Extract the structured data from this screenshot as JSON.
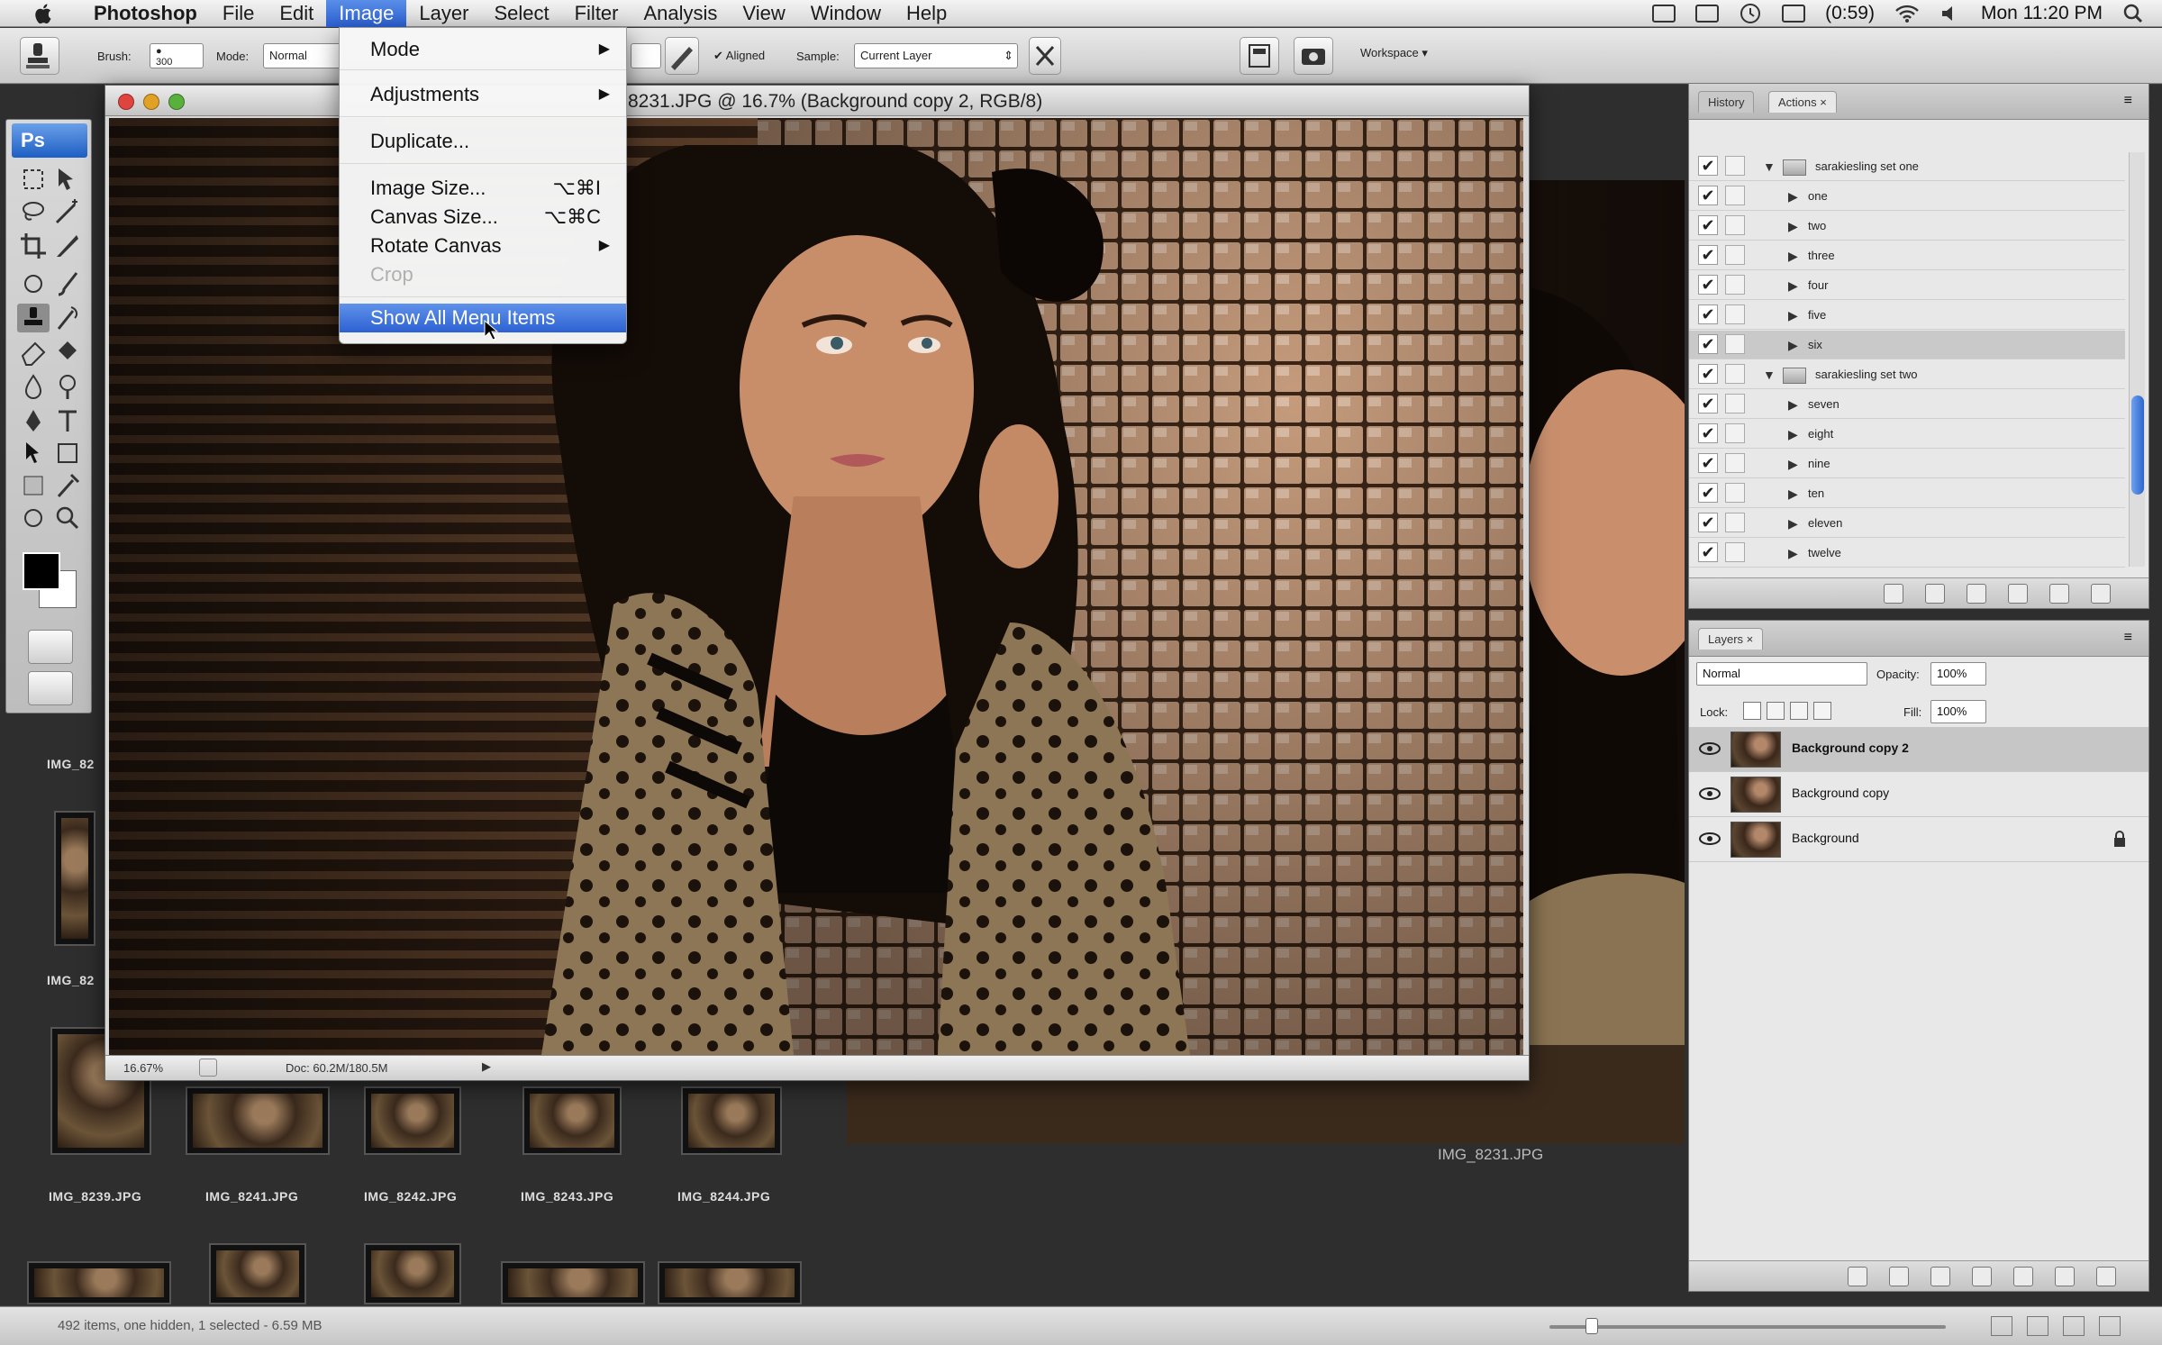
{
  "menubar": {
    "app": "Photoshop",
    "items": [
      "File",
      "Edit",
      "Image",
      "Layer",
      "Select",
      "Filter",
      "Analysis",
      "View",
      "Window",
      "Help"
    ],
    "active": "Image",
    "battery": "(0:59)",
    "clock": "Mon 11:20 PM"
  },
  "options": {
    "brush_label": "Brush:",
    "brush_size": "300",
    "mode_label": "Mode:",
    "mode_value": "Normal",
    "aligned_label": "Aligned",
    "sample_label": "Sample:",
    "sample_value": "Current Layer",
    "workspace_label": "Workspace"
  },
  "toolbox": {
    "logo": "Ps"
  },
  "document": {
    "title": "8231.JPG @ 16.7% (Background copy 2, RGB/8)",
    "zoom": "16.67%",
    "doc_size": "Doc: 60.2M/180.5M"
  },
  "image_menu": {
    "items": [
      {
        "label": "Mode",
        "submenu": true
      },
      {
        "label": "Adjustments",
        "submenu": true
      },
      {
        "label": "Duplicate..."
      },
      {
        "label": "Image Size...",
        "shortcut": "⌥⌘I"
      },
      {
        "label": "Canvas Size...",
        "shortcut": "⌥⌘C"
      },
      {
        "label": "Rotate Canvas",
        "submenu": true
      },
      {
        "label": "Crop",
        "disabled": true
      },
      {
        "label": "Show All Menu Items",
        "highlighted": true
      }
    ]
  },
  "filmstrip": {
    "labels": [
      "IMG_8239.JPG",
      "IMG_8241.JPG",
      "IMG_8242.JPG",
      "IMG_8243.JPG",
      "IMG_8244.JPG"
    ],
    "side_labels": [
      "IMG_82",
      "IMG_82"
    ]
  },
  "preview": {
    "label": "IMG_8231.JPG"
  },
  "actions_panel": {
    "tabs": [
      "History",
      "Actions"
    ],
    "active_tab": "Actions",
    "sets": [
      {
        "name": "sarakiesling set one",
        "actions": [
          "one",
          "two",
          "three",
          "four",
          "five",
          "six"
        ]
      },
      {
        "name": "sarakiesling set two",
        "actions": [
          "seven",
          "eight",
          "nine",
          "ten",
          "eleven",
          "twelve"
        ]
      }
    ],
    "selected_action": "six"
  },
  "layers_panel": {
    "tab": "Layers",
    "blend_mode": "Normal",
    "opacity_label": "Opacity:",
    "opacity_value": "100%",
    "lock_label": "Lock:",
    "fill_label": "Fill:",
    "fill_value": "100%",
    "layers": [
      "Background copy 2",
      "Background copy",
      "Background"
    ],
    "selected_layer": "Background copy 2"
  },
  "statusbar": {
    "text": "492 items, one hidden, 1 selected - 6.59 MB"
  },
  "colors": {
    "menu_highlight": "#2d61d2",
    "panel_bg": "#e8e8e8",
    "bridge_bg": "#2e2e2e"
  }
}
